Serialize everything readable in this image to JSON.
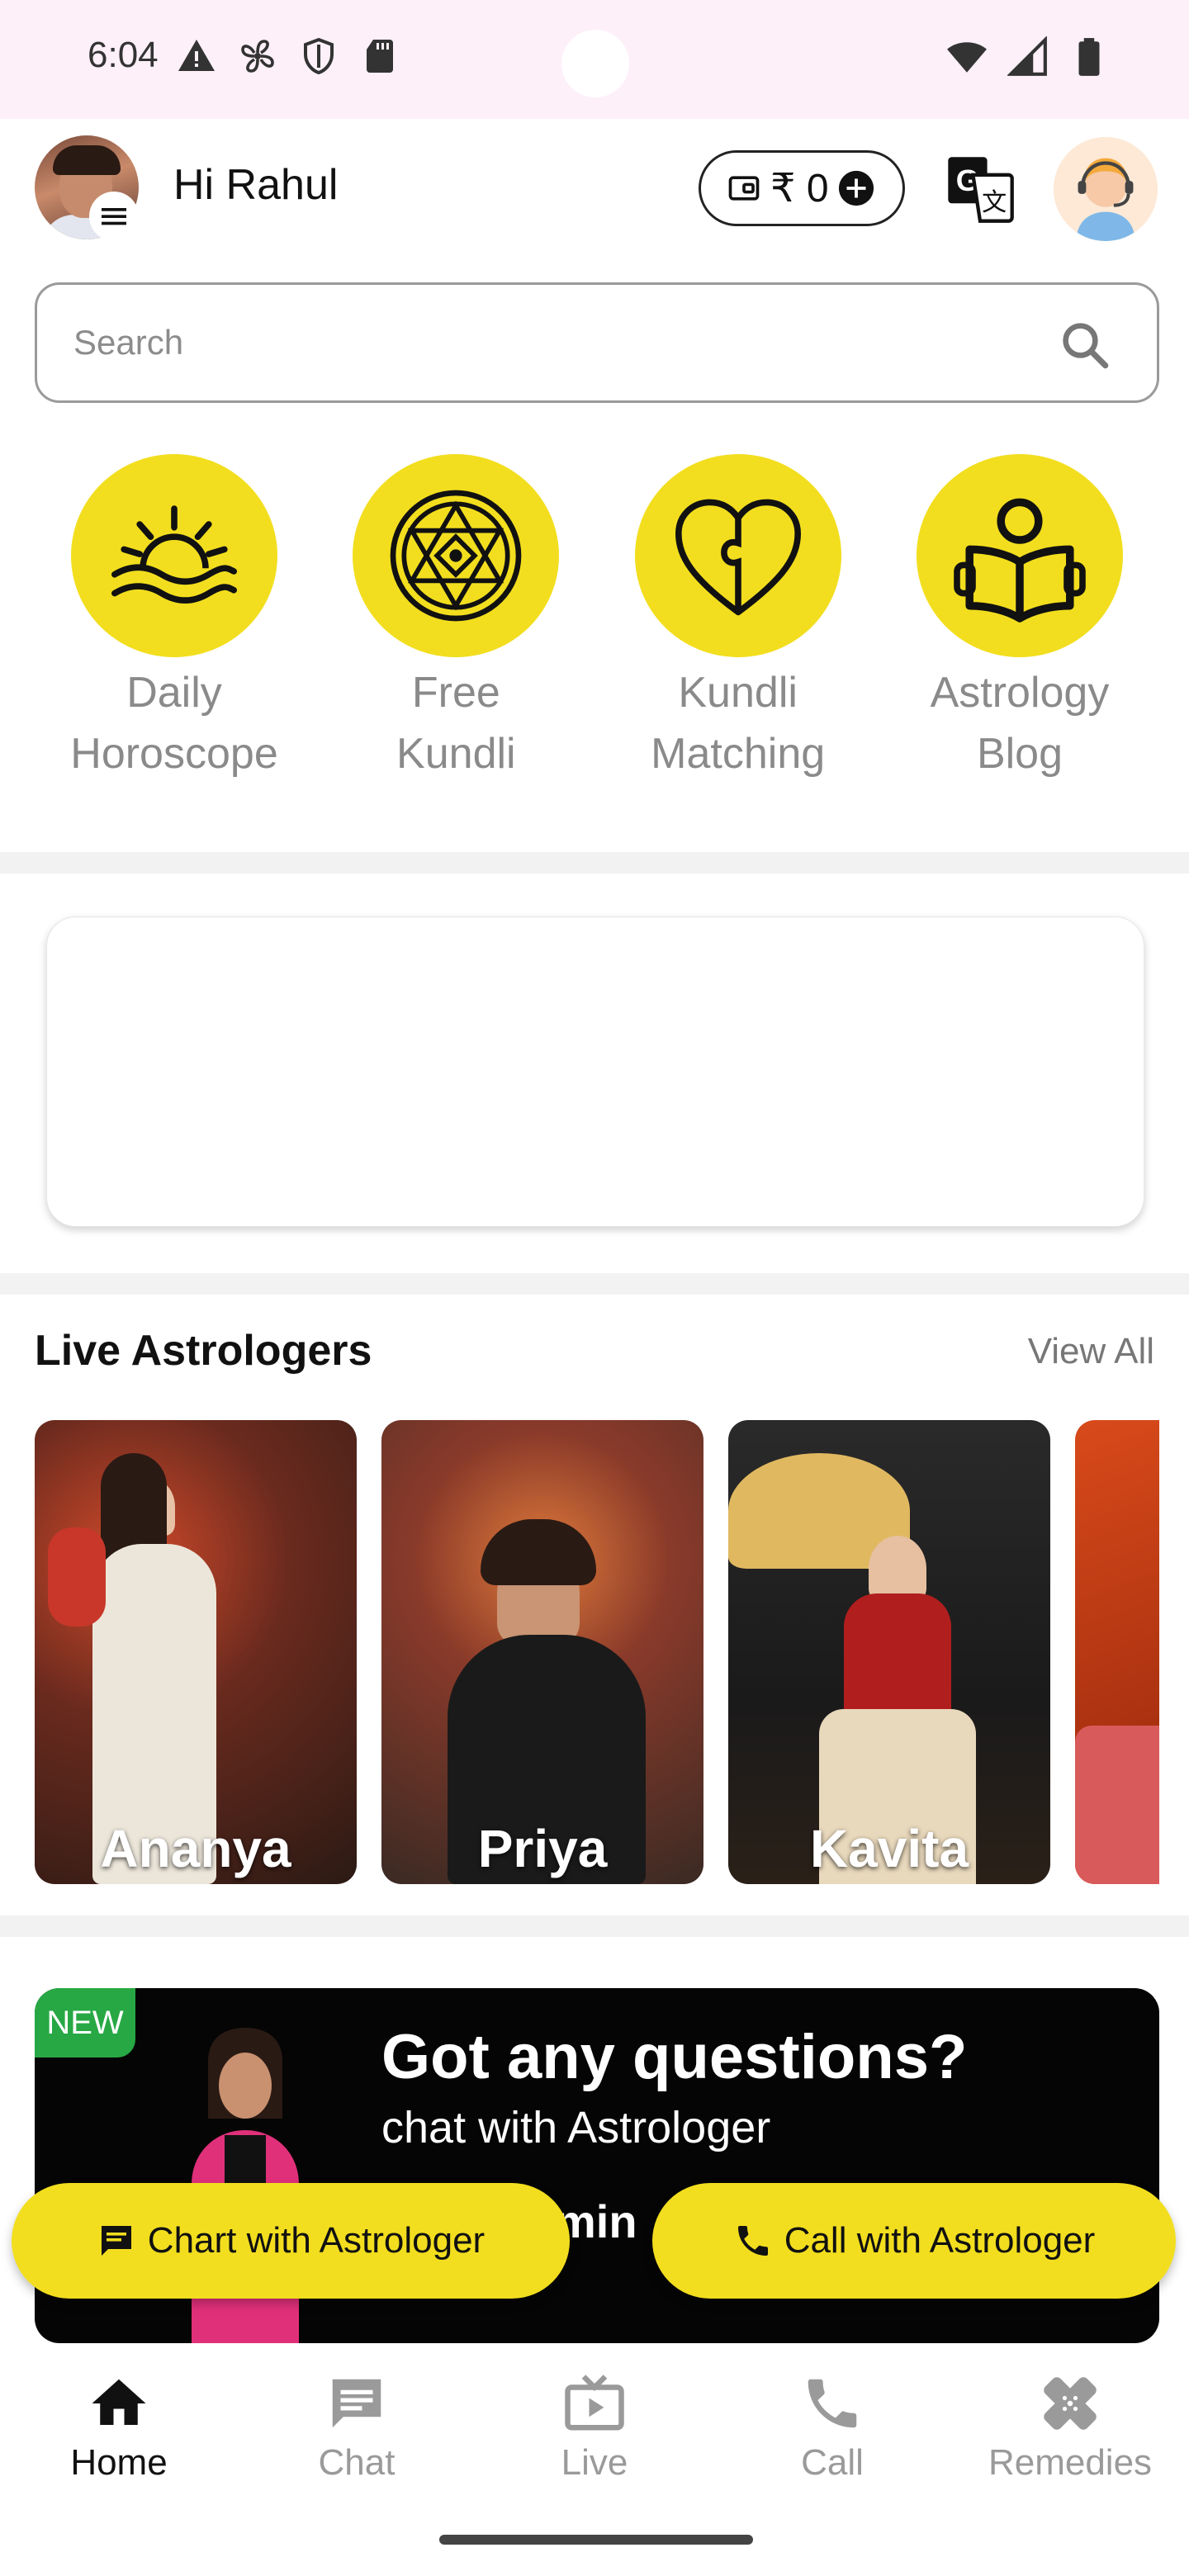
{
  "status_bar": {
    "time": "6:04",
    "icons_left": [
      "warning-icon",
      "fan-icon",
      "shield-icon",
      "sd-card-icon"
    ],
    "icons_right": [
      "wifi-icon",
      "signal-icon",
      "battery-icon"
    ]
  },
  "header": {
    "greeting": "Hi Rahul",
    "wallet_amount": "₹ 0",
    "icons": [
      "menu-icon",
      "wallet-icon",
      "add-icon",
      "translate-icon",
      "support-avatar"
    ]
  },
  "search": {
    "placeholder": "Search"
  },
  "quick_actions": [
    {
      "label_line1": "Daily",
      "label_line2": "Horoscope",
      "icon": "sunrise-icon"
    },
    {
      "label_line1": "Free",
      "label_line2": "Kundli",
      "icon": "kundli-chart-icon"
    },
    {
      "label_line1": "Kundli",
      "label_line2": "Matching",
      "icon": "heart-puzzle-icon"
    },
    {
      "label_line1": "Astrology",
      "label_line2": "Blog",
      "icon": "reader-book-icon"
    }
  ],
  "live_section": {
    "title": "Live Astrologers",
    "view_all": "View All",
    "astrologers": [
      {
        "name": "Ananya"
      },
      {
        "name": "Priya"
      },
      {
        "name": "Kavita"
      },
      {
        "name": ""
      }
    ]
  },
  "promo": {
    "badge": "NEW",
    "title": "Got any questions?",
    "subtitle": "chat with Astrologer",
    "partial_text": "min"
  },
  "fab": {
    "chat_label": "Chart with Astrologer",
    "call_label": "Call with Astrologer"
  },
  "bottom_nav": [
    {
      "label": "Home",
      "icon": "home-icon",
      "active": true
    },
    {
      "label": "Chat",
      "icon": "chat-icon",
      "active": false
    },
    {
      "label": "Live",
      "icon": "live-tv-icon",
      "active": false
    },
    {
      "label": "Call",
      "icon": "phone-icon",
      "active": false
    },
    {
      "label": "Remedies",
      "icon": "remedies-icon",
      "active": false
    }
  ],
  "colors": {
    "accent_yellow": "#f2de1e",
    "status_bar_bg": "#fdf0f8",
    "new_badge_green": "#27a844",
    "promo_bg": "#050505"
  }
}
